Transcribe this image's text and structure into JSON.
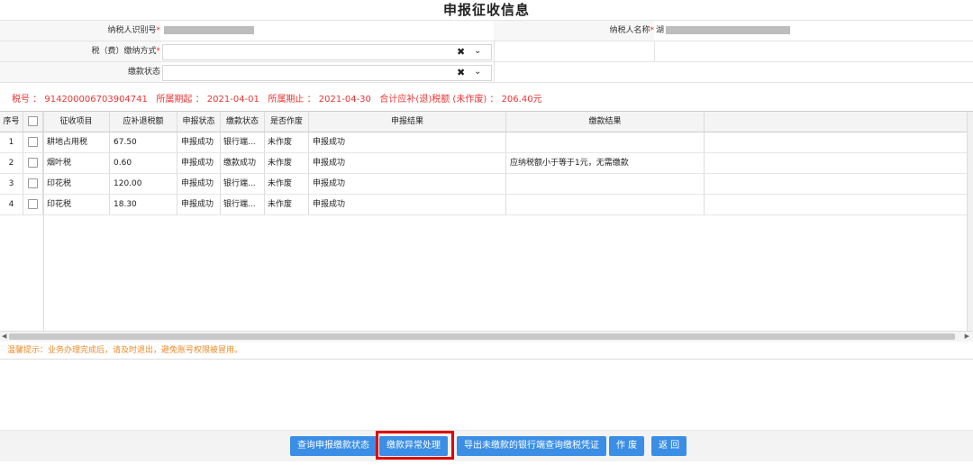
{
  "page": {
    "title": "申报征收信息"
  },
  "form": {
    "taxpayer_id_label": "纳税人识别号",
    "taxpayer_name_label": "纳税人名称",
    "taxpayer_name_prefix": "湖",
    "payment_method_label": "税（费）缴纳方式",
    "payment_status_label": "缴款状态",
    "clear_glyph": "✖",
    "dropdown_glyph": "⌄"
  },
  "summary": {
    "text": "税号 ： 914200006703904741   所属期起 ： 2021-04-01   所属期止 ： 2021-04-30   合计应补(退)税额 (未作废) ： 206.40元"
  },
  "table": {
    "headers": [
      "序号",
      "",
      "征收项目",
      "应补退税额",
      "申报状态",
      "缴款状态",
      "是否作废",
      "申报结果",
      "缴款结果"
    ],
    "rows": [
      {
        "no": "1",
        "item": "耕地占用税",
        "amount": "67.50",
        "decl": "申报成功",
        "pay": "银行端...",
        "void": "未作废",
        "result": "申报成功",
        "payres": ""
      },
      {
        "no": "2",
        "item": "烟叶税",
        "amount": "0.60",
        "decl": "申报成功",
        "pay": "缴款成功",
        "void": "未作废",
        "result": "申报成功",
        "payres": "应纳税额小于等于1元，无需缴款"
      },
      {
        "no": "3",
        "item": "印花税",
        "amount": "120.00",
        "decl": "申报成功",
        "pay": "银行端...",
        "void": "未作废",
        "result": "申报成功",
        "payres": ""
      },
      {
        "no": "4",
        "item": "印花税",
        "amount": "18.30",
        "decl": "申报成功",
        "pay": "银行端...",
        "void": "未作废",
        "result": "申报成功",
        "payres": ""
      }
    ]
  },
  "tip": {
    "text": "温馨提示：业务办理完成后，请及时退出，避免账号权限被冒用。"
  },
  "buttons": {
    "query_status": "查询申报缴款状态",
    "abnormal": "缴款异常处理",
    "export": "导出未缴款的银行端查询缴税凭证",
    "void": "作 废",
    "back": "返 回"
  },
  "colors": {
    "accent": "#3a8ee6",
    "warning": "#e33333",
    "tip": "#f08a24",
    "highlight": "#e00000"
  }
}
